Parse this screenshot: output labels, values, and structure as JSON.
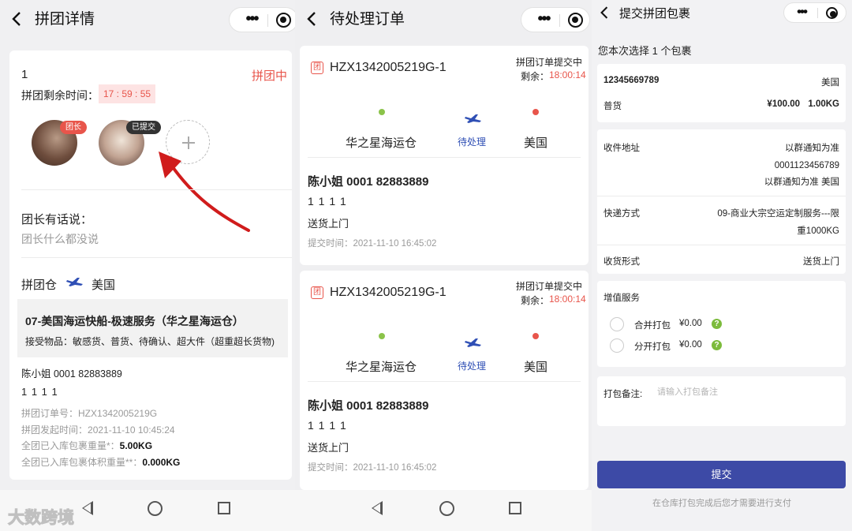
{
  "left": {
    "header": {
      "back_icon": "chevron-left-icon",
      "title": "拼团详情"
    },
    "group": {
      "id": "1",
      "status": "拼团中",
      "remaining_label": "拼团剩余时间：",
      "remaining_time": "17 : 59 : 55",
      "leader_badge": "团长",
      "submitted_badge": "已提交",
      "add_icon": "plus-icon"
    },
    "leader_words": {
      "title": "团长有话说：",
      "text": "团长什么都没说"
    },
    "route": {
      "from": "拼团仓",
      "to": "美国",
      "icon": "plane-icon"
    },
    "service": {
      "name": "07-美国海运快船-极速服务（华之星海运仓）",
      "accepted": "接受物品：敏感货、普货、待确认、超大件（超重超长货物)"
    },
    "recipient": "陈小姐 0001 82883889",
    "address": "1 1 1 1",
    "details": [
      {
        "label": "拼团订单号：",
        "value": "HZX1342005219G"
      },
      {
        "label": "拼团发起时间：",
        "value": "2021-11-10 10:45:24"
      },
      {
        "label": "全团已入库包裹重量*：",
        "value": "5.00KG"
      },
      {
        "label": "全团已入库包裹体积重量**：",
        "value": "0.000KG"
      }
    ],
    "watermark": "大数跨境"
  },
  "middle": {
    "header": {
      "back_icon": "chevron-left-icon",
      "title": "待处理订单"
    },
    "orders": [
      {
        "order_icon": "group-order-icon",
        "order_no": "HZX1342005219G-1",
        "status": "拼团订单提交中",
        "remaining_label": "剩余：",
        "remaining_time": "18:00:14",
        "from": "华之星海运仓",
        "state": "待处理",
        "to": "美国",
        "recipient": "陈小姐 0001 82883889",
        "address": "1 1 1 1",
        "delivery": "送货上门",
        "submit_time": "提交时间：2021-11-10 16:45:02"
      },
      {
        "order_icon": "group-order-icon",
        "order_no": "HZX1342005219G-1",
        "status": "拼团订单提交中",
        "remaining_label": "剩余：",
        "remaining_time": "18:00:14",
        "from": "华之星海运仓",
        "state": "待处理",
        "to": "美国",
        "recipient": "陈小姐 0001 82883889",
        "address": "1 1 1 1",
        "delivery": "送货上门",
        "submit_time": "提交时间：2021-11-10 16:45:02"
      }
    ]
  },
  "right": {
    "header": {
      "back_icon": "chevron-left-icon",
      "title": "提交拼团包裹"
    },
    "summary": "您本次选择 1 个包裹",
    "package": {
      "tracking": "12345669789",
      "country": "美国",
      "type": "普货",
      "price": "¥100.00",
      "weight": "1.00KG"
    },
    "info": {
      "address_label": "收件地址",
      "address_lines": [
        "以群通知为准",
        "0001123456789",
        "以群通知为准 美国"
      ],
      "shipping_label": "快递方式",
      "shipping_lines": [
        "09-商业大宗空运定制服务---限",
        "重1000KG"
      ],
      "receive_label": "收货形式",
      "receive_value": "送货上门"
    },
    "value_added": {
      "title": "增值服务",
      "options": [
        {
          "label": "合并打包",
          "price": "¥0.00",
          "help": "?"
        },
        {
          "label": "分开打包",
          "price": "¥0.00",
          "help": "?"
        }
      ]
    },
    "note": {
      "label": "打包备注:",
      "placeholder": "请输入打包备注"
    },
    "submit_label": "提交",
    "hint": "在仓库打包完成后您才需要进行支付"
  },
  "colors": {
    "accent_red": "#e8554b",
    "submit_blue": "#3d4aa6",
    "green_dot": "#8bc34a",
    "plane_blue": "#2f4fb5"
  }
}
